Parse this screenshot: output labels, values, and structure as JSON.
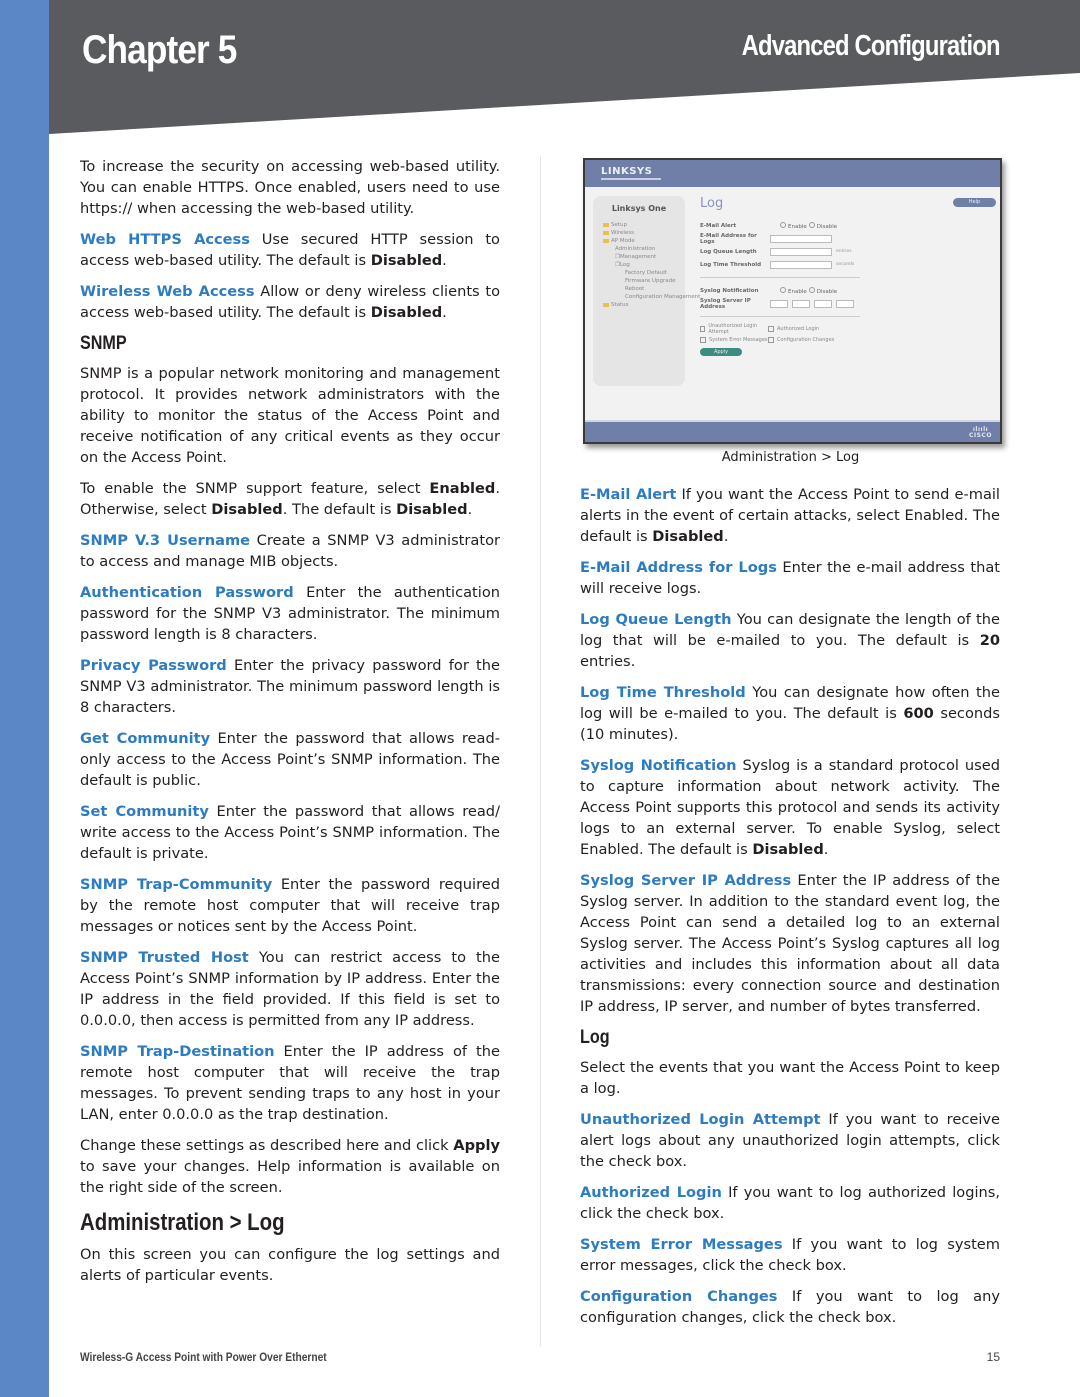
{
  "header": {
    "chapter": "Chapter 5",
    "section": "Advanced Configuration",
    "colors": {
      "band": "#5a5b5e",
      "sidebar": "#5b87c7",
      "term": "#2e7cc0"
    }
  },
  "left": {
    "intro": "To increase the security on accessing web-based utility. You can enable HTTPS. Once enabled, users need to use https:// when accessing the web-based utility.",
    "web_https": {
      "term": "Web HTTPS Access",
      "text": " Use secured HTTP session to access web-based utility. The default is ",
      "bold": "Disabled",
      "end": "."
    },
    "wireless_web": {
      "term": "Wireless Web Access",
      "text": " Allow or deny wireless clients to access web-based utility. The default is ",
      "bold": "Disabled",
      "end": "."
    },
    "snmp_heading": "SNMP",
    "snmp_intro": "SNMP is a popular network monitoring and management protocol. It provides network administrators with the ability to monitor the status of the Access Point and receive notification of any critical events as they occur on the Access Point.",
    "snmp_enable": {
      "t1": "To enable the SNMP support feature, select ",
      "b1": "Enabled",
      "t2": ". Otherwise, select ",
      "b2": "Disabled",
      "t3": ". The default is ",
      "b3": "Disabled",
      "t4": "."
    },
    "v3_username": {
      "term": "SNMP V.3 Username",
      "text": " Create a SNMP V3 administrator to access and manage MIB objects."
    },
    "auth_password": {
      "term": "Authentication Password",
      "text": " Enter the authentication password for the SNMP V3 administrator. The minimum password length is 8 characters."
    },
    "privacy_password": {
      "term": "Privacy Password",
      "text": " Enter the privacy password for the SNMP V3 administrator. The minimum password length is 8 characters."
    },
    "get_community": {
      "term": "Get Community",
      "text": " Enter the password that allows read-only access to the Access Point’s SNMP information. The default is public."
    },
    "set_community": {
      "term": "Set Community",
      "text": " Enter the password that allows read/ write access to the Access Point’s SNMP information. The default is private."
    },
    "trap_community": {
      "term": "SNMP Trap-Community",
      "text": " Enter the password required by the remote host computer that will receive trap messages or notices sent by the Access Point."
    },
    "trusted_host": {
      "term": "SNMP Trusted Host",
      "text": " You can restrict access to the Access Point’s SNMP information by IP address. Enter the IP address in the field provided. If this field is set to 0.0.0.0, then access is permitted from any IP address."
    },
    "trap_destination": {
      "term": "SNMP Trap-Destination",
      "text": " Enter the IP address of the remote host computer that will receive the trap messages. To prevent sending traps to any host in your LAN, enter 0.0.0.0 as the trap destination."
    },
    "apply_note": {
      "t1": "Change these settings as described here and click ",
      "b1": "Apply",
      "t2": " to save your changes. Help information is available on the right side of the screen."
    },
    "admin_log_heading": "Administration > Log",
    "admin_log_intro": "On this screen you can configure the log settings and alerts of particular events."
  },
  "figure": {
    "brand": "LINKSYS",
    "nav_title": "Linksys One",
    "nav_items": [
      "Setup",
      "Wireless",
      "AP Mode",
      "Administration",
      "Management",
      "Log",
      "Factory Default",
      "Firmware Upgrade",
      "Reboot",
      "Configuration Management",
      "Status"
    ],
    "page_title": "Log",
    "help_button": "Help",
    "fields": {
      "email_alert": "E-Mail Alert",
      "email_address": "E-Mail Address for Logs",
      "queue_length": "Log Queue Length",
      "time_threshold": "Log Time Threshold",
      "syslog_notification": "Syslog Notification",
      "syslog_server": "Syslog Server IP Address",
      "enable": "Enable",
      "disable": "Disable",
      "entries": "entries",
      "seconds": "seconds"
    },
    "checkboxes": [
      "Unauthorized Login Attempt",
      "Authorized Login",
      "System Error Messages",
      "Configuration Changes"
    ],
    "apply_button": "Apply",
    "footer_brand": "CISCO",
    "caption": "Administration > Log"
  },
  "right": {
    "email_alert": {
      "term": "E-Mail Alert",
      "text": " If you want the Access Point to send e-mail alerts in the event of certain attacks, select Enabled. The default is ",
      "bold": "Disabled",
      "end": "."
    },
    "email_address": {
      "term": "E-Mail Address for Logs",
      "text": " Enter the e-mail address that will receive logs."
    },
    "queue_length": {
      "term": "Log Queue Length",
      "text": " You can designate the length of the log that will be e-mailed to you. The default is ",
      "bold": "20",
      "end": " entries."
    },
    "time_threshold": {
      "term": "Log Time Threshold",
      "text": " You can designate how often the log will be e-mailed to you. The default is ",
      "bold": "600",
      "end": " seconds (10 minutes)."
    },
    "syslog_notification": {
      "term": "Syslog Notification",
      "text": " Syslog is a standard protocol used to capture information about network activity. The Access Point supports this protocol and sends its activity logs to an external server. To enable Syslog, select Enabled. The default is ",
      "bold": "Disabled",
      "end": "."
    },
    "syslog_server": {
      "term": "Syslog Server IP Address",
      "text": " Enter the IP address of the Syslog server. In addition to the standard event log, the Access Point can send a detailed log to an external Syslog server. The Access Point’s Syslog captures all log activities and includes this information about all data transmissions: every connection source and destination IP address, IP server, and number of bytes transferred."
    },
    "log_heading": "Log",
    "log_intro": "Select the events that you want the Access Point to keep a log.",
    "unauthorized": {
      "term": "Unauthorized Login Attempt",
      "text": " If you want to receive alert logs about any unauthorized login attempts, click the check box."
    },
    "authorized": {
      "term": "Authorized Login",
      "text": " If you want to log authorized logins, click the check box."
    },
    "system_errors": {
      "term": "System Error Messages",
      "text": " If you want to log system error messages, click the check box."
    },
    "config_changes": {
      "term": "Configuration Changes",
      "text": " If you want to log any configuration changes, click the check box."
    }
  },
  "footer": {
    "product": "Wireless-G Access Point with  Power Over Ethernet",
    "page_number": "15"
  }
}
